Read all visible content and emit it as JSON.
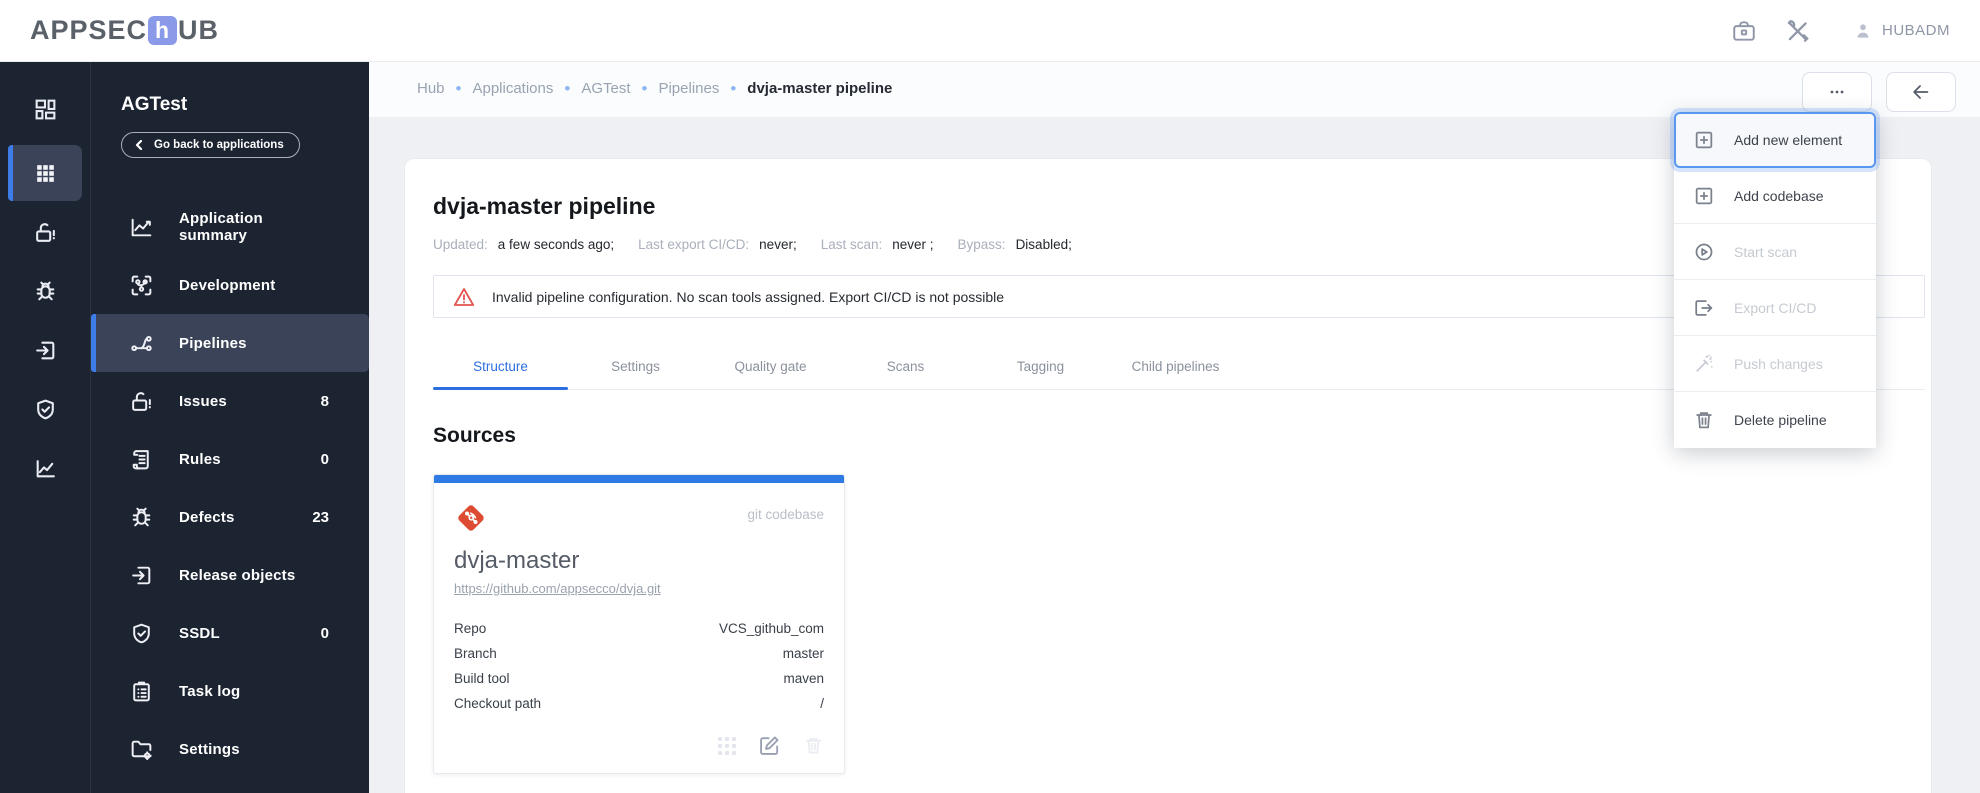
{
  "header": {
    "logo_prefix": "APPSEC",
    "logo_mid": "h",
    "logo_suffix": "UB",
    "username": "HUBADM",
    "icons": [
      "briefcase-icon",
      "tools-icon",
      "user-icon"
    ]
  },
  "colors": {
    "accent_blue": "#2c6fe2",
    "sidebar_bg": "#1c2331",
    "selected_item_bg": "#3a4357",
    "selected_bar_blue": "#3e7ce8",
    "warning_red": "#e25450",
    "git_orange": "#dd4b32",
    "page_bg": "#eef0f4",
    "card_topbar_blue": "#2e7be6"
  },
  "sidebar": {
    "app_name": "AGTest",
    "back_button_label": "Go back to applications",
    "items": [
      {
        "label": "Application summary",
        "count": ""
      },
      {
        "label": "Development",
        "count": ""
      },
      {
        "label": "Pipelines",
        "count": ""
      },
      {
        "label": "Issues",
        "count": "8"
      },
      {
        "label": "Rules",
        "count": "0"
      },
      {
        "label": "Defects",
        "count": "23"
      },
      {
        "label": "Release objects",
        "count": ""
      },
      {
        "label": "SSDL",
        "count": "0"
      },
      {
        "label": "Task log",
        "count": ""
      },
      {
        "label": "Settings",
        "count": ""
      }
    ],
    "rail_icons": [
      "dashboard-icon",
      "apps-grid-icon",
      "lock-open-alert-icon",
      "bug-icon",
      "release-icon",
      "shield-check-icon",
      "chart-icon"
    ]
  },
  "breadcrumb": {
    "crumbs": [
      "Hub",
      "Applications",
      "AGTest",
      "Pipelines"
    ],
    "current": "dvja-master pipeline"
  },
  "page": {
    "title": "dvja-master pipeline",
    "meta": [
      {
        "label": "Updated:",
        "value": "a few seconds ago;"
      },
      {
        "label": "Last export CI/CD:",
        "value": "never;"
      },
      {
        "label": "Last scan:",
        "value": "never ;"
      },
      {
        "label": "Bypass:",
        "value": "Disabled;"
      }
    ],
    "warning_text": "Invalid pipeline configuration. No scan tools assigned. Export CI/CD is not possible",
    "tabs": [
      "Structure",
      "Settings",
      "Quality gate",
      "Scans",
      "Tagging",
      "Child pipelines"
    ],
    "sources_heading": "Sources"
  },
  "source_card": {
    "type_label": "git codebase",
    "title": "dvja-master",
    "url": "https://github.com/appsecco/dvja.git",
    "rows": [
      {
        "label": "Repo",
        "value": "VCS_github_com"
      },
      {
        "label": "Branch",
        "value": "master"
      },
      {
        "label": "Build tool",
        "value": "maven"
      },
      {
        "label": "Checkout path",
        "value": "/"
      }
    ]
  },
  "menu": {
    "items": [
      {
        "label": "Add new element"
      },
      {
        "label": "Add codebase"
      },
      {
        "label": "Start scan"
      },
      {
        "label": "Export CI/CD"
      },
      {
        "label": "Push changes"
      },
      {
        "label": "Delete pipeline"
      }
    ]
  }
}
